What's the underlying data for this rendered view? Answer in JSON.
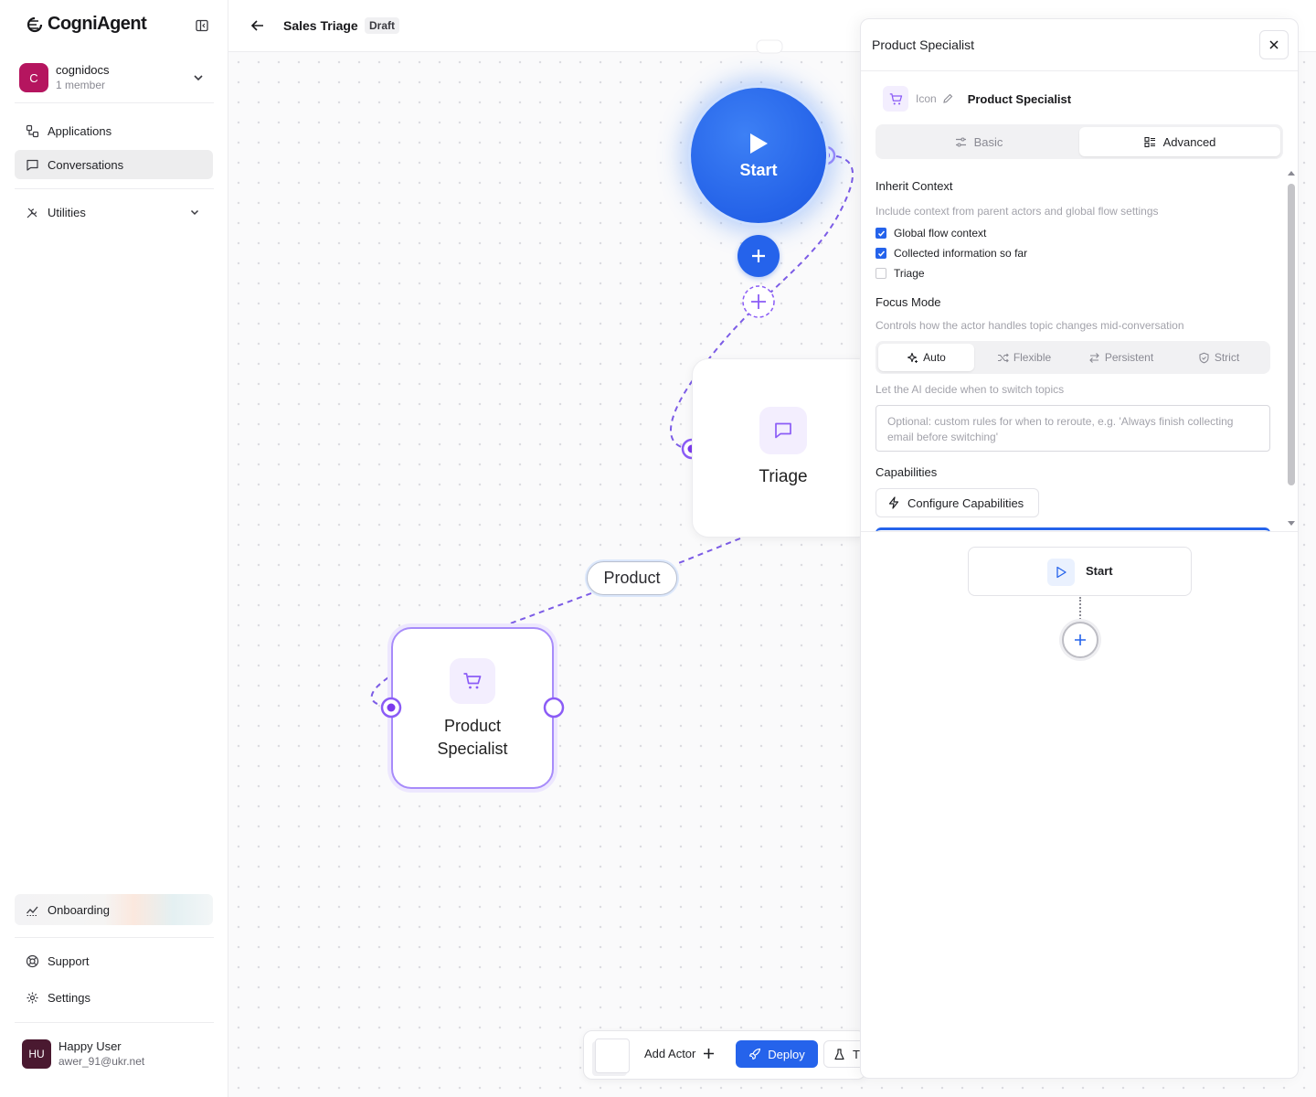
{
  "app": {
    "name": "CogniAgent"
  },
  "org": {
    "initial": "C",
    "name": "cognidocs",
    "members": "1 member"
  },
  "nav": {
    "applications": "Applications",
    "conversations": "Conversations",
    "utilities": "Utilities",
    "onboarding": "Onboarding",
    "support": "Support",
    "settings": "Settings"
  },
  "user": {
    "initials": "HU",
    "name": "Happy User",
    "email": "awer_91@ukr.net"
  },
  "header": {
    "title": "Sales Triage",
    "status": "Draft"
  },
  "canvas": {
    "start_label": "Start",
    "triage_label": "Triage",
    "edge_label": "Product",
    "product_label": "Product Specialist"
  },
  "toolbar": {
    "add_actor": "Add Actor",
    "deploy": "Deploy",
    "test_partial": "T"
  },
  "panel": {
    "title": "Product Specialist",
    "icon_label": "Icon",
    "actor_name": "Product Specialist",
    "tabs": [
      {
        "label": "Basic"
      },
      {
        "label": "Advanced",
        "active": true
      }
    ],
    "inherit": {
      "title": "Inherit Context",
      "description": "Include context from parent actors and global flow settings",
      "options": [
        {
          "label": "Global flow context",
          "checked": true
        },
        {
          "label": "Collected information so far",
          "checked": true
        },
        {
          "label": "Triage",
          "checked": false
        }
      ]
    },
    "focus": {
      "title": "Focus Mode",
      "description": "Controls how the actor handles topic changes mid-conversation",
      "modes": [
        {
          "label": "Auto",
          "active": true
        },
        {
          "label": "Flexible"
        },
        {
          "label": "Persistent"
        },
        {
          "label": "Strict"
        }
      ],
      "hint": "Let the AI decide when to switch topics",
      "rules_placeholder": "Optional: custom rules for when to reroute, e.g. 'Always finish collecting email before switching'"
    },
    "capabilities": {
      "title": "Capabilities",
      "button": "Configure Capabilities"
    },
    "mini_flow": {
      "start_label": "Start"
    }
  },
  "colors": {
    "accent": "#2563eb",
    "node_purple": "#8b5cf6",
    "org_avatar": "#b5155f",
    "user_avatar": "#4a1930"
  }
}
